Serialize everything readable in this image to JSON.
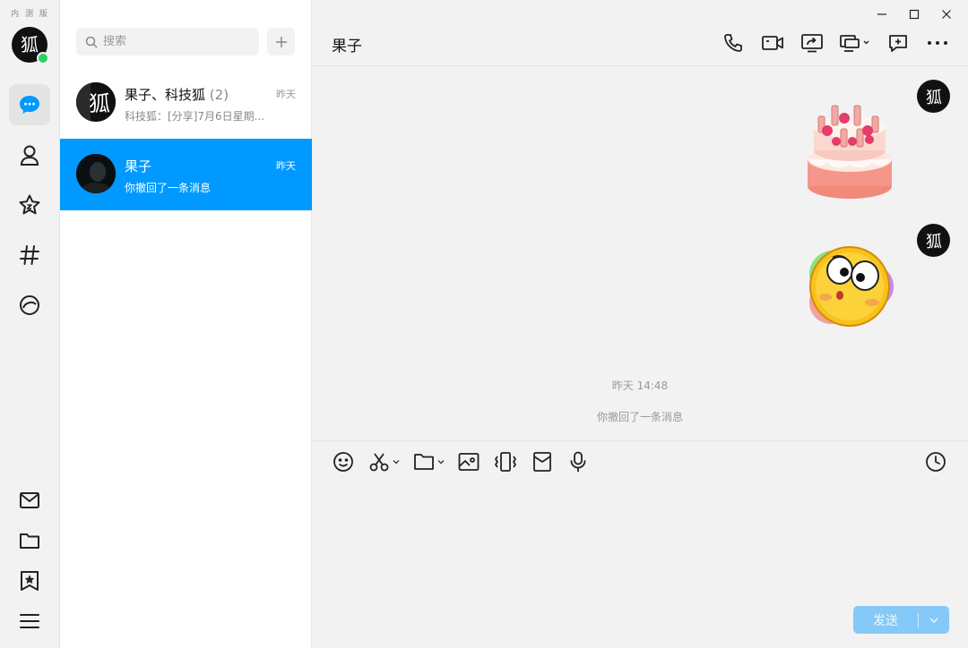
{
  "app": {
    "beta_label": "内 测 版",
    "accent": "#0099ff"
  },
  "rail": {
    "items": [
      {
        "name": "messages",
        "icon": "chat-bubble-icon",
        "active": true
      },
      {
        "name": "contacts",
        "icon": "person-icon",
        "active": false
      },
      {
        "name": "favorites",
        "icon": "star-icon",
        "active": false
      },
      {
        "name": "channels",
        "icon": "hash-icon",
        "active": false
      },
      {
        "name": "discover",
        "icon": "planet-icon",
        "active": false
      }
    ],
    "bottom_items": [
      {
        "name": "mail",
        "icon": "mail-icon"
      },
      {
        "name": "files",
        "icon": "folder-icon"
      },
      {
        "name": "saved",
        "icon": "bookmark-star-icon"
      },
      {
        "name": "menu",
        "icon": "hamburger-icon"
      }
    ]
  },
  "conv_list": {
    "search_placeholder": "搜索",
    "add_icon": "plus-icon",
    "conversations": [
      {
        "name": "果子、科技狐",
        "count": "(2)",
        "time": "昨天",
        "preview": "科技狐：[分享]7月6日星期...",
        "selected": false
      },
      {
        "name": "果子",
        "count": "",
        "time": "昨天",
        "preview": "你撤回了一条消息",
        "selected": true
      }
    ]
  },
  "chat": {
    "title": "果子",
    "header_actions": [
      "phone-icon",
      "video-camera-icon",
      "screen-share-icon",
      "remote-desktop-icon",
      "add-comment-icon",
      "more-icon"
    ],
    "messages": [
      {
        "type": "sticker",
        "sticker": "birthday-cake-sticker",
        "from": "me"
      },
      {
        "type": "sticker",
        "sticker": "surprised-face-sticker",
        "from": "me"
      }
    ],
    "system": {
      "timestamp": "昨天 14:48",
      "recall_notice": "你撤回了一条消息"
    },
    "toolbar": [
      "emoji-icon",
      "scissors-icon",
      "folder-icon",
      "image-icon",
      "shake-icon",
      "red-packet-icon",
      "microphone-icon"
    ],
    "history_icon": "clock-icon",
    "send_label": "发送"
  }
}
